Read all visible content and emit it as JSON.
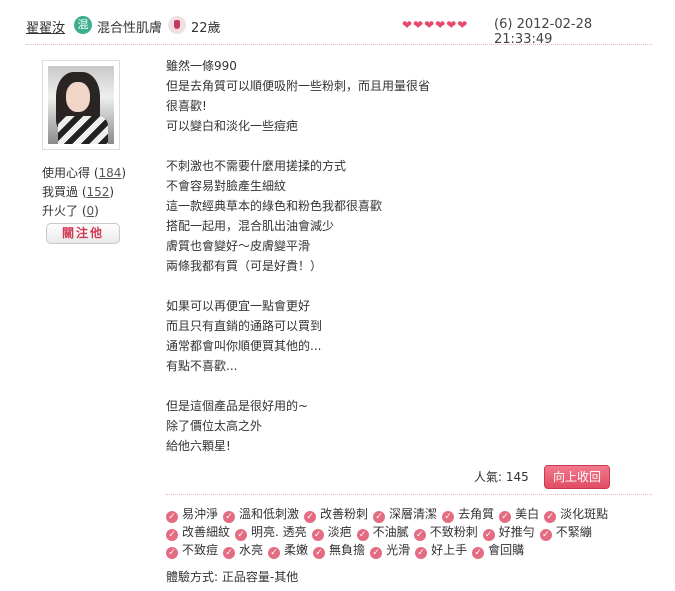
{
  "header": {
    "username": "翟翟汝",
    "skin_badge": "混",
    "skin_type": "混合性肌膚",
    "age": "22歲",
    "hearts": "❤❤❤❤❤❤",
    "rating_count": "(6)",
    "datetime": "2012-02-28 21:33:49"
  },
  "profile": {
    "usage_label": "使用心得",
    "usage_count": "184",
    "bought_label": "我買過",
    "bought_count": "152",
    "level_label": "升火了",
    "level_count": "0",
    "follow_button": "關注他"
  },
  "review": {
    "lines": [
      "雖然一條990",
      "但是去角質可以順便吸附一些粉刺，而且用量很省",
      "很喜歡!",
      "可以變白和淡化一些痘疤",
      "",
      "不刺激也不需要什麼用搓揉的方式",
      "不會容易對臉產生細紋",
      "這一款經典草本的綠色和粉色我都很喜歡",
      "搭配一起用，混合肌出油會減少",
      "膚質也會變好～皮膚變平滑",
      "兩條我都有買（可是好貴！）",
      "",
      "如果可以再便宜一點會更好",
      "而且只有直銷的通路可以買到",
      "通常都會叫你順便買其他的...",
      "有點不喜歡...",
      "",
      "但是這個產品是很好用的~",
      "除了價位太高之外",
      "給他六顆星!"
    ]
  },
  "popularity": {
    "label": "人氣:",
    "value": "145",
    "useful_button": "向上收回"
  },
  "tags": [
    "易沖淨",
    "溫和低刺激",
    "改善粉刺",
    "深層清潔",
    "去角質",
    "美白",
    "淡化斑點",
    "改善細紋",
    "明亮. 透亮",
    "淡疤",
    "不油膩",
    "不致粉刺",
    "好推勻",
    "不緊繃",
    "不致痘",
    "水亮",
    "柔嫩",
    "無負擔",
    "光滑",
    "好上手",
    "會回購"
  ],
  "experience": "體驗方式: 正品容量-其他"
}
